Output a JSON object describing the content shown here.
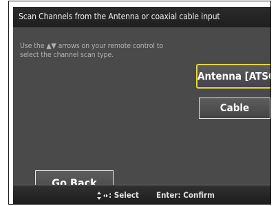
{
  "header": {
    "title": "Scan Channels from the Antenna or coaxial cable input"
  },
  "main": {
    "instruction": "Use the ▲▼ arrows on your remote control to select the channel scan type.",
    "options": [
      {
        "label": "Antenna [ATSC]",
        "selected": true
      },
      {
        "label": "Cable",
        "selected": false
      }
    ],
    "back_label": "Go Back"
  },
  "footer": {
    "select_hint": ": Select",
    "select_icon": "up-down-left-right-arrows-icon",
    "confirm_hint": "Enter: Confirm"
  },
  "colors": {
    "background": "#4a4a4a",
    "title_bar": "#222222",
    "highlight_border": "#e8d23a",
    "button_border": "#e8e8e8"
  }
}
